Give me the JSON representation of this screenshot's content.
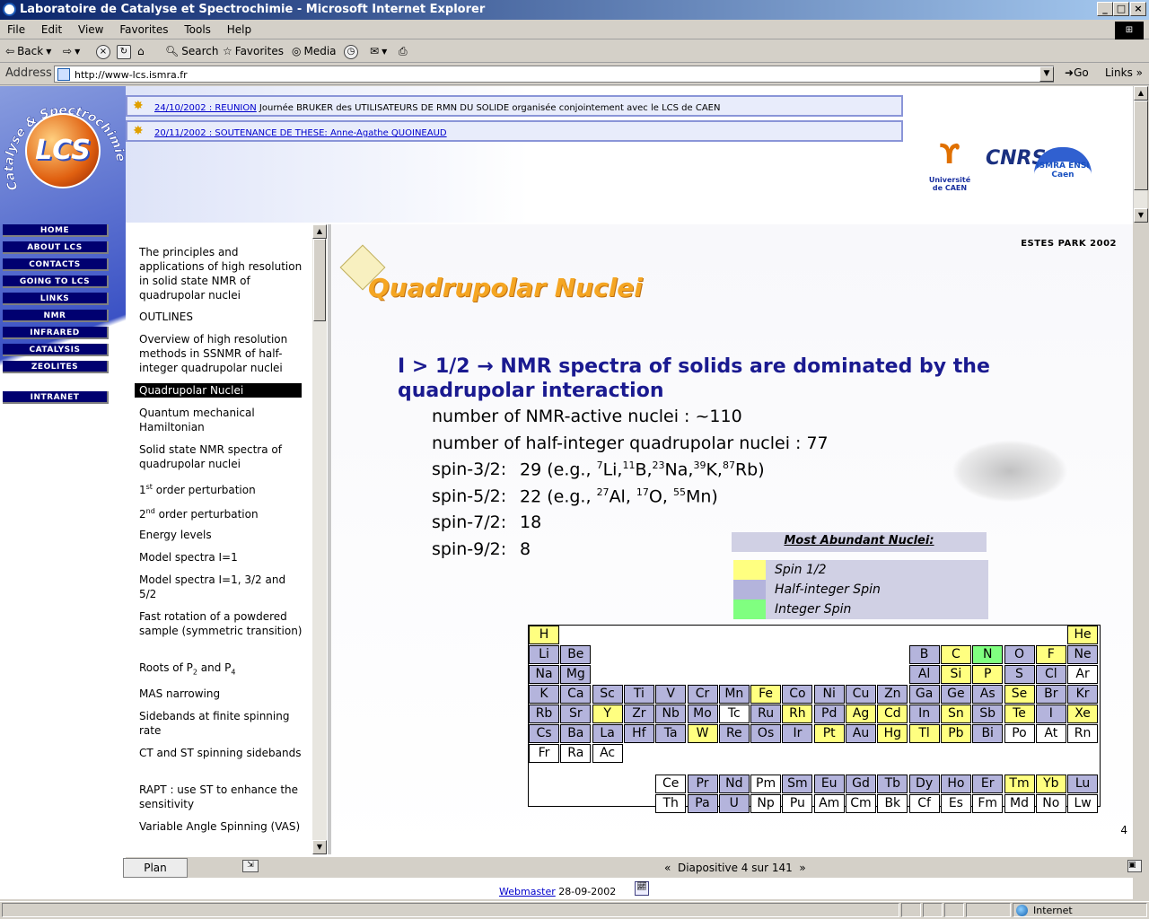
{
  "window": {
    "title": "Laboratoire de Catalyse et Spectrochimie - Microsoft Internet Explorer",
    "buttons": [
      "_",
      "□",
      "×"
    ]
  },
  "menu": [
    "File",
    "Edit",
    "View",
    "Favorites",
    "Tools",
    "Help"
  ],
  "toolbar": {
    "back": "Back",
    "search": "Search",
    "favorites": "Favorites",
    "media": "Media"
  },
  "address": {
    "label": "Address",
    "url": "http://www-lcs.ismra.fr",
    "go": "Go",
    "links": "Links"
  },
  "banner": {
    "logo_text": "LCS",
    "arch_text": "Catalyse & Spectrochimie",
    "news": [
      {
        "date_link": "24/10/2002 : REUNION",
        "text": " Journée BRUKER des UTILISATEURS DE RMN DU SOLIDE organisée conjointement avec le LCS de CAEN"
      },
      {
        "date_link": "20/11/2002 : SOUTENANCE DE THESE: Anne-Agathe QUOINEAUD",
        "text": ""
      }
    ],
    "partners": {
      "caen": "Université de CAEN",
      "cnrs": "CNRS",
      "ismra": "ISMRA ENSI Caen"
    }
  },
  "nav": [
    "HOME",
    "ABOUT LCS",
    "CONTACTS",
    "GOING TO LCS",
    "LINKS",
    "NMR",
    "INFRARED",
    "CATALYSIS",
    "ZEOLITES",
    "INTRANET"
  ],
  "outline": {
    "items": [
      "The principles and applications of high resolution in solid state NMR of quadrupolar nuclei",
      "OUTLINES",
      " Overview of high resolution methods in SSNMR of half-integer quadrupolar nuclei",
      "Quadrupolar Nuclei",
      "Quantum mechanical Hamiltonian",
      "Solid state NMR spectra of quadrupolar nuclei",
      "1st order perturbation",
      "2nd order perturbation",
      "Energy levels",
      "Model  spectra   I=1",
      "Model spectra   I=1, 3/2 and 5/2",
      "  Fast rotation of a powdered sample (symmetric transition)",
      "Roots of P2 and P4",
      "MAS narrowing",
      "Sidebands at finite spinning rate",
      "CT and ST spinning sidebands",
      "RAPT : use ST to enhance the sensitivity",
      "Variable Angle Spinning (VAS)"
    ],
    "selected_index": 3,
    "plan_label": "Plan"
  },
  "slide": {
    "conference": "ESTES  PARK 2002",
    "title": "Quadrupolar Nuclei",
    "headline": "I  > 1/2 → NMR spectra of solids are dominated by the quadrupolar interaction",
    "line1": "number of NMR-active nuclei : ~110",
    "line2": "number of half-integer quadrupolar nuclei : 77",
    "spin32_label": "spin-3/2:",
    "spin32_value": "29",
    "spin52_label": "spin-5/2:",
    "spin52_value": "22",
    "spin72_label": "spin-7/2:",
    "spin72_value": "18",
    "spin92_label": "spin-9/2:",
    "spin92_value": "8",
    "legend_title": "Most Abundant Nuclei:",
    "legend": [
      {
        "label": "Spin 1/2",
        "color": "#ffff80"
      },
      {
        "label": "Half-integer Spin",
        "color": "#b4b4dc"
      },
      {
        "label": "Integer Spin",
        "color": "#80ff80"
      }
    ],
    "page_number": "4",
    "counter": "Diapositive 4 sur 141"
  },
  "periodic_colors": {
    "y": "#ffff80",
    "p": "#b4b4dc",
    "g": "#80ff80",
    "w": "#ffffff"
  },
  "periodic_table": [
    {
      "s": "H",
      "r": 0,
      "c": 0,
      "t": "y"
    },
    {
      "s": "He",
      "r": 0,
      "c": 17,
      "t": "y"
    },
    {
      "s": "Li",
      "r": 1,
      "c": 0,
      "t": "p"
    },
    {
      "s": "Be",
      "r": 1,
      "c": 1,
      "t": "p"
    },
    {
      "s": "B",
      "r": 1,
      "c": 12,
      "t": "p"
    },
    {
      "s": "C",
      "r": 1,
      "c": 13,
      "t": "y"
    },
    {
      "s": "N",
      "r": 1,
      "c": 14,
      "t": "g"
    },
    {
      "s": "O",
      "r": 1,
      "c": 15,
      "t": "p"
    },
    {
      "s": "F",
      "r": 1,
      "c": 16,
      "t": "y"
    },
    {
      "s": "Ne",
      "r": 1,
      "c": 17,
      "t": "p"
    },
    {
      "s": "Na",
      "r": 2,
      "c": 0,
      "t": "p"
    },
    {
      "s": "Mg",
      "r": 2,
      "c": 1,
      "t": "p"
    },
    {
      "s": "Al",
      "r": 2,
      "c": 12,
      "t": "p"
    },
    {
      "s": "Si",
      "r": 2,
      "c": 13,
      "t": "y"
    },
    {
      "s": "P",
      "r": 2,
      "c": 14,
      "t": "y"
    },
    {
      "s": "S",
      "r": 2,
      "c": 15,
      "t": "p"
    },
    {
      "s": "Cl",
      "r": 2,
      "c": 16,
      "t": "p"
    },
    {
      "s": "Ar",
      "r": 2,
      "c": 17,
      "t": "w"
    },
    {
      "s": "K",
      "r": 3,
      "c": 0,
      "t": "p"
    },
    {
      "s": "Ca",
      "r": 3,
      "c": 1,
      "t": "p"
    },
    {
      "s": "Sc",
      "r": 3,
      "c": 2,
      "t": "p"
    },
    {
      "s": "Ti",
      "r": 3,
      "c": 3,
      "t": "p"
    },
    {
      "s": "V",
      "r": 3,
      "c": 4,
      "t": "p"
    },
    {
      "s": "Cr",
      "r": 3,
      "c": 5,
      "t": "p"
    },
    {
      "s": "Mn",
      "r": 3,
      "c": 6,
      "t": "p"
    },
    {
      "s": "Fe",
      "r": 3,
      "c": 7,
      "t": "y"
    },
    {
      "s": "Co",
      "r": 3,
      "c": 8,
      "t": "p"
    },
    {
      "s": "Ni",
      "r": 3,
      "c": 9,
      "t": "p"
    },
    {
      "s": "Cu",
      "r": 3,
      "c": 10,
      "t": "p"
    },
    {
      "s": "Zn",
      "r": 3,
      "c": 11,
      "t": "p"
    },
    {
      "s": "Ga",
      "r": 3,
      "c": 12,
      "t": "p"
    },
    {
      "s": "Ge",
      "r": 3,
      "c": 13,
      "t": "p"
    },
    {
      "s": "As",
      "r": 3,
      "c": 14,
      "t": "p"
    },
    {
      "s": "Se",
      "r": 3,
      "c": 15,
      "t": "y"
    },
    {
      "s": "Br",
      "r": 3,
      "c": 16,
      "t": "p"
    },
    {
      "s": "Kr",
      "r": 3,
      "c": 17,
      "t": "p"
    },
    {
      "s": "Rb",
      "r": 4,
      "c": 0,
      "t": "p"
    },
    {
      "s": "Sr",
      "r": 4,
      "c": 1,
      "t": "p"
    },
    {
      "s": "Y",
      "r": 4,
      "c": 2,
      "t": "y"
    },
    {
      "s": "Zr",
      "r": 4,
      "c": 3,
      "t": "p"
    },
    {
      "s": "Nb",
      "r": 4,
      "c": 4,
      "t": "p"
    },
    {
      "s": "Mo",
      "r": 4,
      "c": 5,
      "t": "p"
    },
    {
      "s": "Tc",
      "r": 4,
      "c": 6,
      "t": "w"
    },
    {
      "s": "Ru",
      "r": 4,
      "c": 7,
      "t": "p"
    },
    {
      "s": "Rh",
      "r": 4,
      "c": 8,
      "t": "y"
    },
    {
      "s": "Pd",
      "r": 4,
      "c": 9,
      "t": "p"
    },
    {
      "s": "Ag",
      "r": 4,
      "c": 10,
      "t": "y"
    },
    {
      "s": "Cd",
      "r": 4,
      "c": 11,
      "t": "y"
    },
    {
      "s": "In",
      "r": 4,
      "c": 12,
      "t": "p"
    },
    {
      "s": "Sn",
      "r": 4,
      "c": 13,
      "t": "y"
    },
    {
      "s": "Sb",
      "r": 4,
      "c": 14,
      "t": "p"
    },
    {
      "s": "Te",
      "r": 4,
      "c": 15,
      "t": "y"
    },
    {
      "s": "I",
      "r": 4,
      "c": 16,
      "t": "p"
    },
    {
      "s": "Xe",
      "r": 4,
      "c": 17,
      "t": "y"
    },
    {
      "s": "Cs",
      "r": 5,
      "c": 0,
      "t": "p"
    },
    {
      "s": "Ba",
      "r": 5,
      "c": 1,
      "t": "p"
    },
    {
      "s": "La",
      "r": 5,
      "c": 2,
      "t": "p"
    },
    {
      "s": "Hf",
      "r": 5,
      "c": 3,
      "t": "p"
    },
    {
      "s": "Ta",
      "r": 5,
      "c": 4,
      "t": "p"
    },
    {
      "s": "W",
      "r": 5,
      "c": 5,
      "t": "y"
    },
    {
      "s": "Re",
      "r": 5,
      "c": 6,
      "t": "p"
    },
    {
      "s": "Os",
      "r": 5,
      "c": 7,
      "t": "p"
    },
    {
      "s": "Ir",
      "r": 5,
      "c": 8,
      "t": "p"
    },
    {
      "s": "Pt",
      "r": 5,
      "c": 9,
      "t": "y"
    },
    {
      "s": "Au",
      "r": 5,
      "c": 10,
      "t": "p"
    },
    {
      "s": "Hg",
      "r": 5,
      "c": 11,
      "t": "y"
    },
    {
      "s": "Tl",
      "r": 5,
      "c": 12,
      "t": "y"
    },
    {
      "s": "Pb",
      "r": 5,
      "c": 13,
      "t": "y"
    },
    {
      "s": "Bi",
      "r": 5,
      "c": 14,
      "t": "p"
    },
    {
      "s": "Po",
      "r": 5,
      "c": 15,
      "t": "w"
    },
    {
      "s": "At",
      "r": 5,
      "c": 16,
      "t": "w"
    },
    {
      "s": "Rn",
      "r": 5,
      "c": 17,
      "t": "w"
    },
    {
      "s": "Fr",
      "r": 6,
      "c": 0,
      "t": "w"
    },
    {
      "s": "Ra",
      "r": 6,
      "c": 1,
      "t": "w"
    },
    {
      "s": "Ac",
      "r": 6,
      "c": 2,
      "t": "w"
    },
    {
      "s": "Ce",
      "r": 7,
      "c": 4,
      "t": "w"
    },
    {
      "s": "Pr",
      "r": 7,
      "c": 5,
      "t": "p"
    },
    {
      "s": "Nd",
      "r": 7,
      "c": 6,
      "t": "p"
    },
    {
      "s": "Pm",
      "r": 7,
      "c": 7,
      "t": "w"
    },
    {
      "s": "Sm",
      "r": 7,
      "c": 8,
      "t": "p"
    },
    {
      "s": "Eu",
      "r": 7,
      "c": 9,
      "t": "p"
    },
    {
      "s": "Gd",
      "r": 7,
      "c": 10,
      "t": "p"
    },
    {
      "s": "Tb",
      "r": 7,
      "c": 11,
      "t": "p"
    },
    {
      "s": "Dy",
      "r": 7,
      "c": 12,
      "t": "p"
    },
    {
      "s": "Ho",
      "r": 7,
      "c": 13,
      "t": "p"
    },
    {
      "s": "Er",
      "r": 7,
      "c": 14,
      "t": "p"
    },
    {
      "s": "Tm",
      "r": 7,
      "c": 15,
      "t": "y"
    },
    {
      "s": "Yb",
      "r": 7,
      "c": 16,
      "t": "y"
    },
    {
      "s": "Lu",
      "r": 7,
      "c": 17,
      "t": "p"
    },
    {
      "s": "Th",
      "r": 8,
      "c": 4,
      "t": "w"
    },
    {
      "s": "Pa",
      "r": 8,
      "c": 5,
      "t": "p"
    },
    {
      "s": "U",
      "r": 8,
      "c": 6,
      "t": "p"
    },
    {
      "s": "Np",
      "r": 8,
      "c": 7,
      "t": "w"
    },
    {
      "s": "Pu",
      "r": 8,
      "c": 8,
      "t": "w"
    },
    {
      "s": "Am",
      "r": 8,
      "c": 9,
      "t": "w"
    },
    {
      "s": "Cm",
      "r": 8,
      "c": 10,
      "t": "w"
    },
    {
      "s": "Bk",
      "r": 8,
      "c": 11,
      "t": "w"
    },
    {
      "s": "Cf",
      "r": 8,
      "c": 12,
      "t": "w"
    },
    {
      "s": "Es",
      "r": 8,
      "c": 13,
      "t": "w"
    },
    {
      "s": "Fm",
      "r": 8,
      "c": 14,
      "t": "w"
    },
    {
      "s": "Md",
      "r": 8,
      "c": 15,
      "t": "w"
    },
    {
      "s": "No",
      "r": 8,
      "c": 16,
      "t": "w"
    },
    {
      "s": "Lw",
      "r": 8,
      "c": 17,
      "t": "w"
    }
  ],
  "footer": {
    "webmaster": "Webmaster",
    "date": " 28-09-2002"
  },
  "status": {
    "zone": "Internet"
  }
}
